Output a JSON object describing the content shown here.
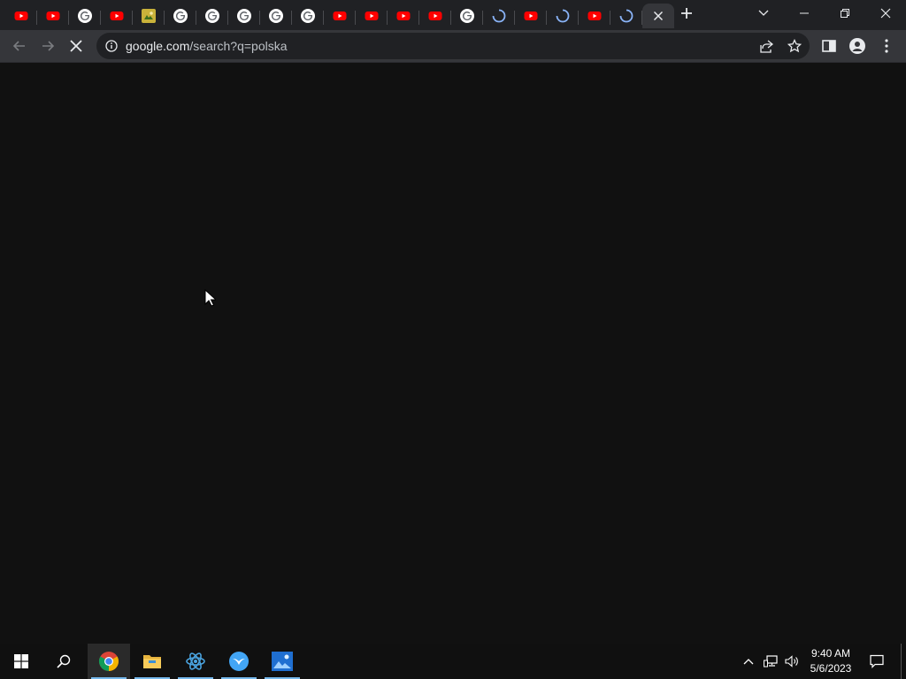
{
  "browser": {
    "tabs": [
      {
        "favicon": "youtube-icon"
      },
      {
        "favicon": "youtube-icon"
      },
      {
        "favicon": "google-icon"
      },
      {
        "favicon": "youtube-icon"
      },
      {
        "favicon": "image-favicon-icon"
      },
      {
        "favicon": "google-icon"
      },
      {
        "favicon": "google-icon"
      },
      {
        "favicon": "google-icon"
      },
      {
        "favicon": "google-icon"
      },
      {
        "favicon": "google-icon"
      },
      {
        "favicon": "youtube-icon"
      },
      {
        "favicon": "youtube-icon"
      },
      {
        "favicon": "youtube-icon"
      },
      {
        "favicon": "youtube-icon"
      },
      {
        "favicon": "google-icon"
      },
      {
        "favicon": "loading-spinner-icon"
      },
      {
        "favicon": "youtube-icon"
      },
      {
        "favicon": "loading-spinner-icon"
      },
      {
        "favicon": "youtube-icon"
      },
      {
        "favicon": "loading-spinner-icon"
      },
      {
        "favicon": "close-icon",
        "active": true
      }
    ],
    "address_bar": {
      "host": "google.com",
      "path": "/search?q=polska"
    }
  },
  "taskbar": {
    "apps": [
      {
        "name": "chrome-icon",
        "active": true
      },
      {
        "name": "file-explorer-icon"
      },
      {
        "name": "electron-app-icon"
      },
      {
        "name": "bird-app-icon"
      },
      {
        "name": "photos-icon"
      }
    ],
    "clock": {
      "time": "9:40 AM",
      "date": "5/6/2023"
    }
  },
  "colors": {
    "tabstrip": "#202124",
    "toolbar": "#35363a",
    "omnibox": "#202124",
    "page": "#111111",
    "taskbar": "#101010",
    "youtube_red": "#ff0000",
    "loading_blue": "#8ab4f8",
    "taskbar_indicator": "#76b9ed"
  }
}
